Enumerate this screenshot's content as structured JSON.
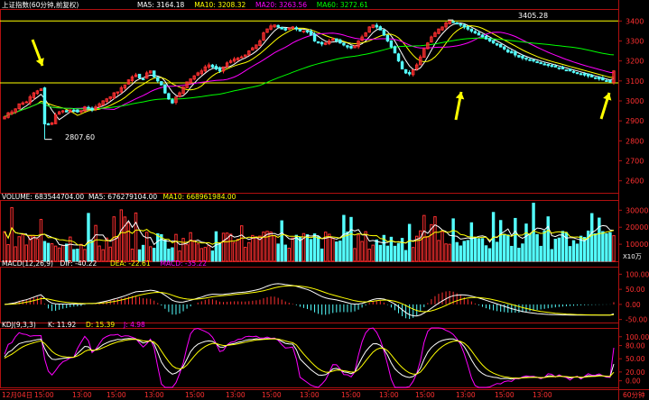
{
  "panels": {
    "main": {
      "title": "上证指数(60分钟,前复权)",
      "ma_items": [
        {
          "label": "MA5: 3164.18",
          "color": "#ffffff"
        },
        {
          "label": "MA10: 3208.32",
          "color": "#ffff00"
        },
        {
          "label": "MA20: 3263.56",
          "color": "#ff00ff"
        },
        {
          "label": "MA60: 3272.61",
          "color": "#00ff00"
        }
      ],
      "y_ticks": [
        "3400",
        "3300",
        "3200",
        "3100",
        "3000",
        "2900",
        "2800",
        "2700",
        "2600"
      ],
      "annotations": {
        "low": "2807.60",
        "high": "3405.28"
      },
      "ylim": [
        2540,
        3460
      ],
      "h_lines": [
        3400,
        3090
      ]
    },
    "volume": {
      "title_items": [
        {
          "label": "VOLUME: 683544704.00",
          "color": "#ffffff"
        },
        {
          "label": "MA5: 676279104.00",
          "color": "#ffffff"
        },
        {
          "label": "MA10: 668961984.00",
          "color": "#ffff00"
        }
      ],
      "y_ticks": [
        "30000",
        "20000",
        "10000"
      ],
      "unit": "X10万",
      "ylim": [
        0,
        36000
      ]
    },
    "macd": {
      "title_items": [
        {
          "label": "MACD(12,26,9)",
          "color": "#ffffff"
        },
        {
          "label": "DIF: -40.22",
          "color": "#ffffff"
        },
        {
          "label": "DEA: -22.61",
          "color": "#ffff00"
        },
        {
          "label": "MACD: -35.22",
          "color": "#ff00ff"
        }
      ],
      "y_ticks": [
        "100.00",
        "50.00",
        "0.00",
        "-50.00"
      ],
      "ylim": [
        -60,
        125
      ]
    },
    "kdj": {
      "title_items": [
        {
          "label": "KDJ(9,3,3)",
          "color": "#ffffff"
        },
        {
          "label": "K: 11.92",
          "color": "#ffffff"
        },
        {
          "label": "D: 15.39",
          "color": "#ffff00"
        },
        {
          "label": "J: 4.98",
          "color": "#ff00ff"
        }
      ],
      "y_ticks": [
        "100.00",
        "80.00",
        "50.00",
        "20.00",
        "0.00"
      ],
      "ylim": [
        -15,
        120
      ]
    }
  },
  "x_axis": {
    "labels": [
      "12月04日",
      "15:00",
      "13:00",
      "15:00",
      "13:00",
      "15:00",
      "13:00",
      "15:00",
      "13:00",
      "15:00",
      "13:00",
      "15:00",
      "13:00",
      "15:00",
      "13:00",
      "60分钟"
    ]
  },
  "colors": {
    "up": "#ff3030",
    "down": "#54ffff",
    "ma5": "#ffffff",
    "ma10": "#ffff00",
    "ma20": "#ff00ff",
    "ma60": "#00ff00",
    "axis": "#b01010",
    "hline": "#ffff00",
    "arrow": "#ffff00"
  },
  "chart_data": [
    {
      "type": "candlestick",
      "series_name": "上证指数",
      "x": [
        0,
        1,
        2,
        3,
        4,
        5,
        6,
        7,
        8,
        9,
        10,
        11,
        12,
        13,
        14,
        15,
        16,
        17,
        18,
        19,
        20,
        21,
        22,
        23,
        24,
        25,
        26,
        27,
        28,
        29,
        30,
        31,
        32,
        33,
        34,
        35,
        36,
        37,
        38,
        39,
        40,
        41,
        42,
        43,
        44,
        45,
        46,
        47,
        48,
        49,
        50,
        51,
        52,
        53,
        54,
        55,
        56,
        57,
        58,
        59,
        60,
        61,
        62,
        63,
        64,
        65,
        66,
        67,
        68,
        69,
        70,
        71,
        72,
        73,
        74,
        75,
        76,
        77,
        78,
        79,
        80,
        81,
        82,
        83,
        84,
        85,
        86,
        87,
        88,
        89,
        90,
        91,
        92,
        93,
        94,
        95,
        96,
        97,
        98,
        99,
        100,
        101,
        102,
        103,
        104,
        105,
        106,
        107,
        108,
        109,
        110,
        111,
        112,
        113,
        114,
        115,
        116,
        117,
        118,
        119,
        120,
        121,
        122,
        123,
        124,
        125,
        126,
        127,
        128,
        129,
        130,
        131,
        132,
        133,
        134,
        135,
        136,
        137,
        138,
        139,
        140,
        141,
        142,
        143,
        144,
        145,
        146,
        147,
        148,
        149,
        150,
        151,
        152,
        153,
        154,
        155,
        156,
        157,
        158,
        159,
        160,
        161,
        162,
        163,
        164,
        165,
        166,
        167
      ],
      "close": [
        2920,
        2940,
        2945,
        2960,
        2985,
        2990,
        2995,
        3020,
        3040,
        3050,
        3060,
        2885,
        2880,
        2890,
        2930,
        2945,
        2950,
        2945,
        2955,
        2950,
        2945,
        2950,
        2970,
        2965,
        2955,
        2970,
        2985,
        3000,
        3010,
        3020,
        3040,
        3045,
        3065,
        3080,
        3105,
        3120,
        3130,
        3115,
        3110,
        3140,
        3150,
        3120,
        3100,
        3080,
        3040,
        3010,
        2990,
        3020,
        3040,
        3070,
        3095,
        3110,
        3125,
        3140,
        3150,
        3170,
        3180,
        3170,
        3160,
        3150,
        3170,
        3190,
        3200,
        3210,
        3215,
        3220,
        3230,
        3250,
        3265,
        3280,
        3300,
        3340,
        3360,
        3375,
        3380,
        3370,
        3360,
        3355,
        3365,
        3370,
        3360,
        3350,
        3350,
        3345,
        3330,
        3300,
        3290,
        3285,
        3290,
        3300,
        3310,
        3300,
        3290,
        3280,
        3270,
        3265,
        3275,
        3300,
        3320,
        3340,
        3370,
        3380,
        3370,
        3355,
        3330,
        3300,
        3270,
        3240,
        3200,
        3160,
        3140,
        3135,
        3155,
        3180,
        3220,
        3260,
        3290,
        3320,
        3340,
        3360,
        3370,
        3390,
        3400,
        3395,
        3385,
        3380,
        3370,
        3360,
        3350,
        3340,
        3330,
        3320,
        3310,
        3300,
        3290,
        3280,
        3270,
        3260,
        3245,
        3240,
        3230,
        3220,
        3215,
        3210,
        3205,
        3200,
        3195,
        3190,
        3185,
        3180,
        3175,
        3170,
        3165,
        3160,
        3155,
        3150,
        3145,
        3140,
        3135,
        3130,
        3125,
        3120,
        3115,
        3110,
        3105,
        3100,
        3095,
        3150
      ]
    },
    {
      "type": "bar",
      "series_name": "VOLUME",
      "x": "same as candlestick",
      "values": "approximate per-bar volume in units of X10万 (derived in script)"
    },
    {
      "type": "macd",
      "series_name": "MACD(12,26,9)"
    },
    {
      "type": "line",
      "series_name": "KDJ(9,3,3)"
    }
  ]
}
